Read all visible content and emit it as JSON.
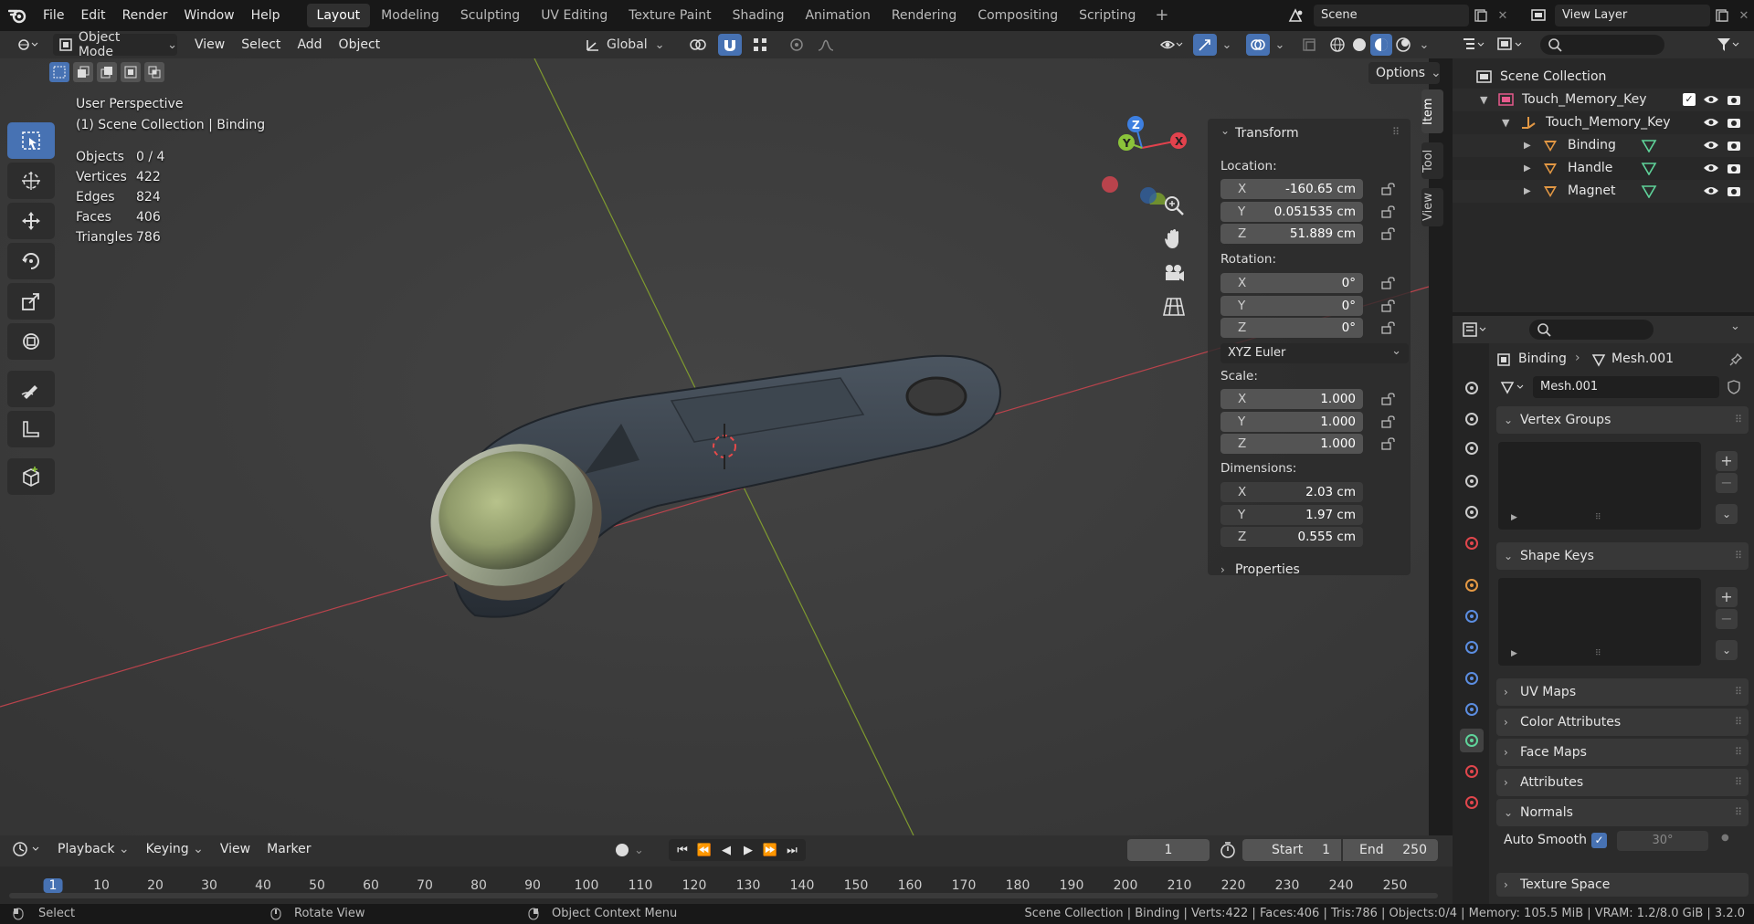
{
  "menus": [
    "File",
    "Edit",
    "Render",
    "Window",
    "Help"
  ],
  "workspaces": [
    "Layout",
    "Modeling",
    "Sculpting",
    "UV Editing",
    "Texture Paint",
    "Shading",
    "Animation",
    "Rendering",
    "Compositing",
    "Scripting"
  ],
  "active_workspace": "Layout",
  "scene": "Scene",
  "view_layer": "View Layer",
  "viewport_header": {
    "mode": "Object Mode",
    "menus": [
      "View",
      "Select",
      "Add",
      "Object"
    ],
    "orientation": "Global",
    "options": "Options"
  },
  "overlay": {
    "perspective": "User Perspective",
    "collection": "(1) Scene Collection | Binding",
    "stats": [
      {
        "label": "Objects",
        "value": "0 / 4"
      },
      {
        "label": "Vertices",
        "value": "422"
      },
      {
        "label": "Edges",
        "value": "824"
      },
      {
        "label": "Faces",
        "value": "406"
      },
      {
        "label": "Triangles",
        "value": "786"
      }
    ]
  },
  "transform": {
    "title": "Transform",
    "location_label": "Location:",
    "location": [
      {
        "axis": "X",
        "value": "-160.65 cm"
      },
      {
        "axis": "Y",
        "value": "0.051535 cm"
      },
      {
        "axis": "Z",
        "value": "51.889 cm"
      }
    ],
    "rotation_label": "Rotation:",
    "rotation": [
      {
        "axis": "X",
        "value": "0°"
      },
      {
        "axis": "Y",
        "value": "0°"
      },
      {
        "axis": "Z",
        "value": "0°"
      }
    ],
    "rotation_mode": "XYZ Euler",
    "scale_label": "Scale:",
    "scale": [
      {
        "axis": "X",
        "value": "1.000"
      },
      {
        "axis": "Y",
        "value": "1.000"
      },
      {
        "axis": "Z",
        "value": "1.000"
      }
    ],
    "dimensions_label": "Dimensions:",
    "dimensions": [
      {
        "axis": "X",
        "value": "2.03 cm"
      },
      {
        "axis": "Y",
        "value": "1.97 cm"
      },
      {
        "axis": "Z",
        "value": "0.555 cm"
      }
    ],
    "properties": "Properties"
  },
  "npanel_tabs": [
    "Item",
    "Tool",
    "View"
  ],
  "outliner": {
    "root": "Scene Collection",
    "collection": "Touch_Memory_Key",
    "empty": "Touch_Memory_Key",
    "objects": [
      "Binding",
      "Handle",
      "Magnet"
    ]
  },
  "properties": {
    "object": "Binding",
    "mesh": "Mesh.001",
    "datablock": "Mesh.001",
    "panels": {
      "vertex_groups": "Vertex Groups",
      "shape_keys": "Shape Keys",
      "uv_maps": "UV Maps",
      "color_attributes": "Color Attributes",
      "face_maps": "Face Maps",
      "attributes": "Attributes",
      "normals": "Normals",
      "texture_space": "Texture Space"
    },
    "auto_smooth_label": "Auto Smooth",
    "auto_smooth_angle": "30°"
  },
  "timeline": {
    "menus": [
      "Playback",
      "Keying",
      "View",
      "Marker"
    ],
    "current_frame": "1",
    "start_label": "Start",
    "start": "1",
    "end_label": "End",
    "end": "250",
    "ruler": [
      "1",
      "10",
      "20",
      "30",
      "40",
      "50",
      "60",
      "70",
      "80",
      "90",
      "100",
      "110",
      "120",
      "130",
      "140",
      "150",
      "160",
      "170",
      "180",
      "190",
      "200",
      "210",
      "220",
      "230",
      "240",
      "250"
    ]
  },
  "statusbar": {
    "select": "Select",
    "rotate": "Rotate View",
    "context": "Object Context Menu",
    "info": "Scene Collection | Binding | Verts:422 | Faces:406 | Tris:786 | Objects:0/4 | Memory: 105.5 MiB | VRAM: 1.2/8.0 GiB | 3.2.0"
  },
  "colors": {
    "accent": "#4772b3",
    "x_axis": "#e2424d",
    "y_axis": "#8bc43a",
    "z_axis": "#3d7fe0",
    "bg_viewport": "#3d3d3d"
  }
}
